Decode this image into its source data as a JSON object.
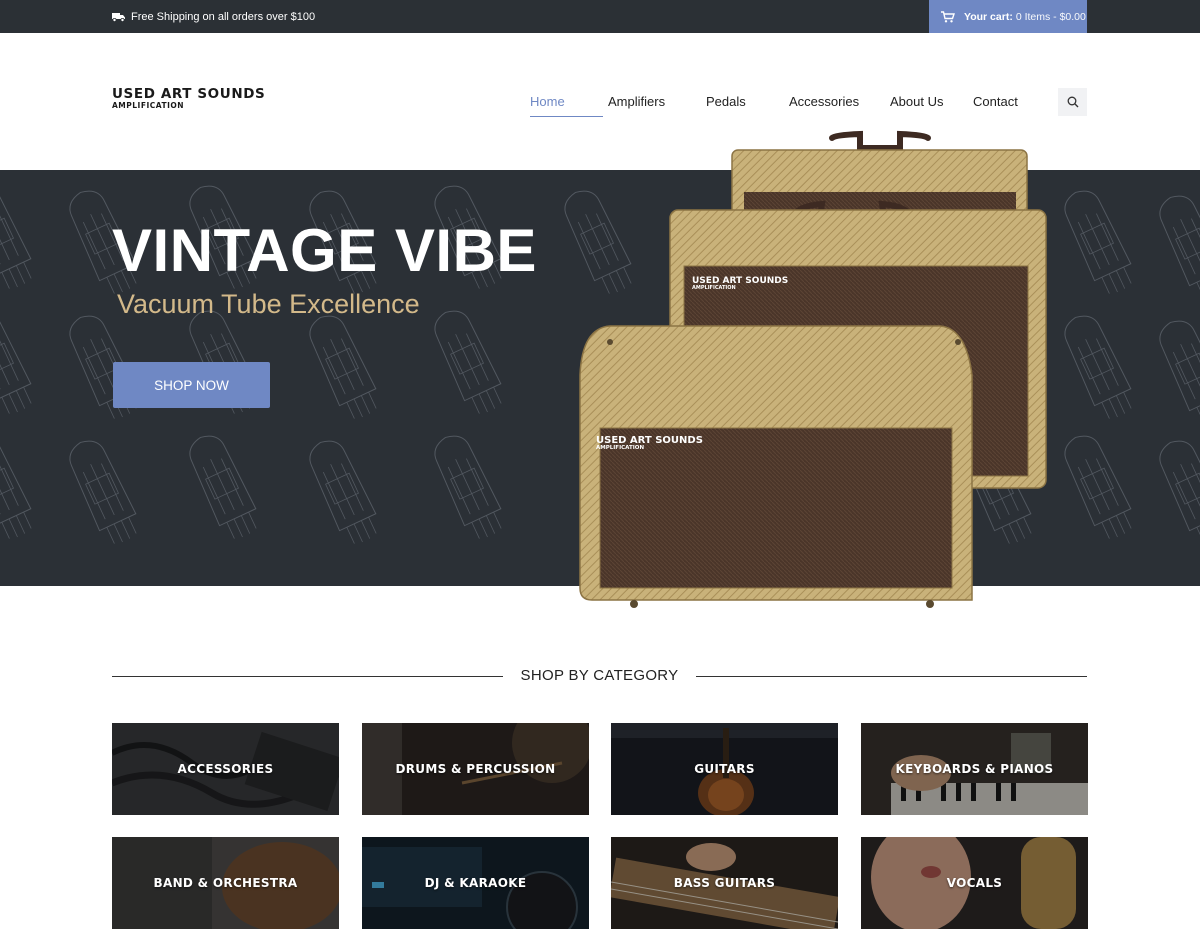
{
  "topbar": {
    "shipping_text": "Free Shipping on all orders over $100",
    "cart_label": "Your cart:",
    "cart_value": "0 Items - $0.00"
  },
  "header": {
    "logo_line1": "USED ART SOUNDS",
    "logo_line2": "AMPLIFICATION",
    "nav": [
      "Home",
      "Amplifiers",
      "Pedals",
      "Accessories",
      "About Us",
      "Contact"
    ],
    "active_nav": "Home"
  },
  "hero": {
    "title": "VINTAGE VIBE",
    "subtitle": "Vacuum Tube Excellence",
    "cta": "SHOP NOW",
    "amp_badge_line1": "USED ART SOUNDS",
    "amp_badge_line2": "AMPLIFICATION"
  },
  "categories": {
    "heading": "SHOP BY CATEGORY",
    "items": [
      {
        "label": "ACCESSORIES"
      },
      {
        "label": "DRUMS & PERCUSSION"
      },
      {
        "label": "GUITARS"
      },
      {
        "label": "KEYBOARDS & PIANOS"
      },
      {
        "label": "BAND & ORCHESTRA"
      },
      {
        "label": "DJ & KARAOKE"
      },
      {
        "label": "BASS GUITARS"
      },
      {
        "label": "VOCALS"
      }
    ]
  },
  "colors": {
    "accent": "#6f88c4",
    "dark": "#2b3036",
    "gold": "#d3b98a"
  }
}
